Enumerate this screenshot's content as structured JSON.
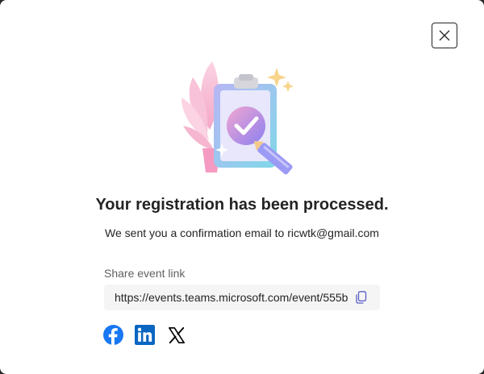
{
  "dialog": {
    "title": "Your registration has been processed.",
    "subtitle": "We sent you a confirmation email to ricwtk@gmail.com",
    "close_icon": "close-icon",
    "illustration": "clipboard-checkmark-illustration"
  },
  "share": {
    "label": "Share event link",
    "url": "https://events.teams.microsoft.com/event/555b",
    "copy_icon": "copy-icon"
  },
  "social": [
    {
      "name": "facebook",
      "icon": "facebook-icon",
      "color": "#1877F2"
    },
    {
      "name": "linkedin",
      "icon": "linkedin-icon",
      "color": "#0A66C2"
    },
    {
      "name": "x",
      "icon": "x-icon",
      "color": "#000000"
    }
  ],
  "colors": {
    "text": "#242424",
    "muted": "#616161",
    "field_bg": "#f5f5f5",
    "accent": "#5B5FC7"
  }
}
